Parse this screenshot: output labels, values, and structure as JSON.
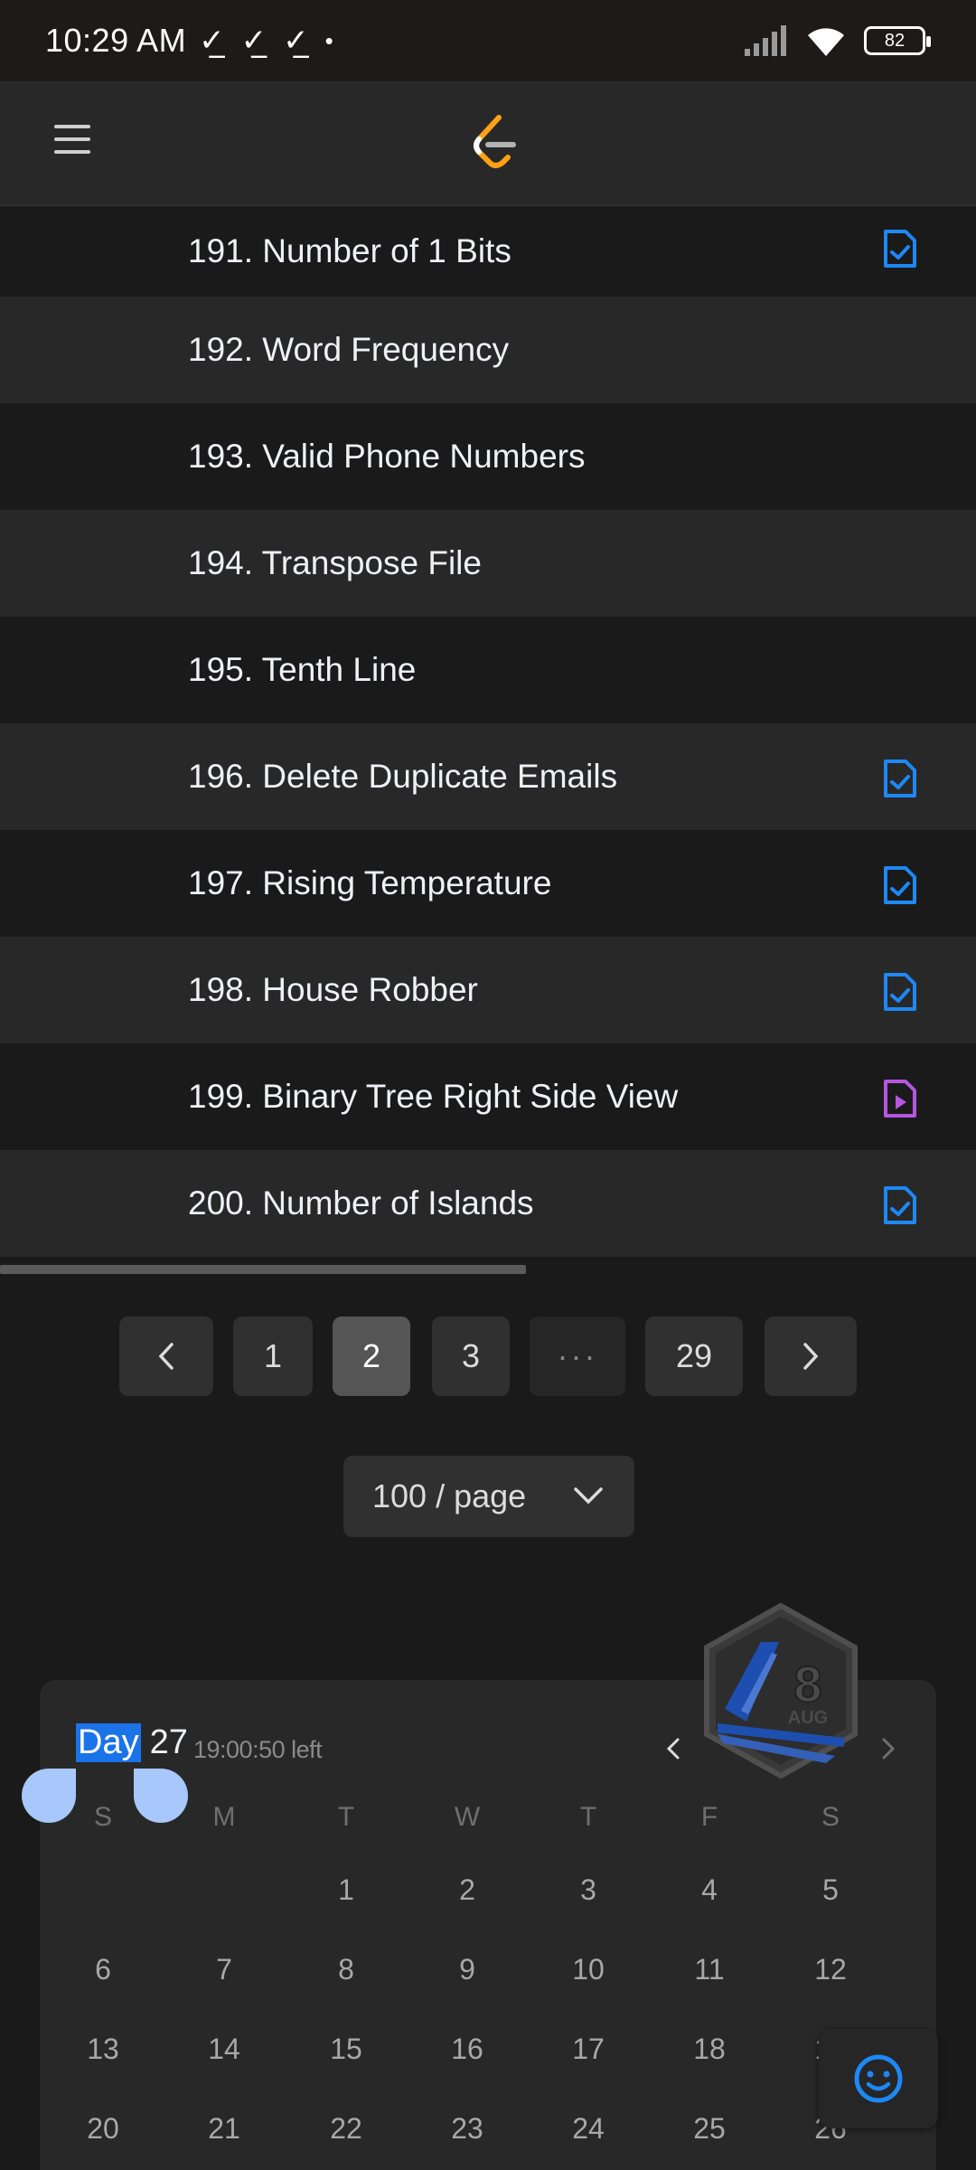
{
  "status_bar": {
    "time": "10:29 AM",
    "notification_icons": [
      "check-icon",
      "check-icon",
      "check-icon"
    ],
    "battery": "82"
  },
  "header": {
    "menu_icon": "hamburger-menu-icon",
    "logo": "leetcode-logo"
  },
  "problems": [
    {
      "title": "191. Number of 1 Bits",
      "status": "solved"
    },
    {
      "title": "192. Word Frequency",
      "status": "none"
    },
    {
      "title": "193. Valid Phone Numbers",
      "status": "none"
    },
    {
      "title": "194. Transpose File",
      "status": "none"
    },
    {
      "title": "195. Tenth Line",
      "status": "none"
    },
    {
      "title": "196. Delete Duplicate Emails",
      "status": "solved"
    },
    {
      "title": "197. Rising Temperature",
      "status": "solved"
    },
    {
      "title": "198. House Robber",
      "status": "solved"
    },
    {
      "title": "199. Binary Tree Right Side View",
      "status": "video"
    },
    {
      "title": "200. Number of Islands",
      "status": "solved"
    }
  ],
  "pagination": {
    "pages": [
      "1",
      "2",
      "3",
      "···",
      "29"
    ],
    "current": "2",
    "page_size": "100 / page"
  },
  "calendar": {
    "day_word": "Day",
    "day_number": "27",
    "time_left": "19:00:50 left",
    "badge_day": "8",
    "badge_month": "AUG",
    "weekdays": [
      "S",
      "M",
      "T",
      "W",
      "T",
      "F",
      "S"
    ],
    "weeks": [
      [
        "",
        "",
        "1",
        "2",
        "3",
        "4",
        "5"
      ],
      [
        "6",
        "7",
        "8",
        "9",
        "10",
        "11",
        "12"
      ],
      [
        "13",
        "14",
        "15",
        "16",
        "17",
        "18",
        "19"
      ],
      [
        "20",
        "21",
        "22",
        "23",
        "24",
        "25",
        "26"
      ]
    ]
  },
  "colors": {
    "solved_icon": "#1e88f5",
    "video_icon": "#b456e0",
    "selection": "#1a73e8"
  }
}
